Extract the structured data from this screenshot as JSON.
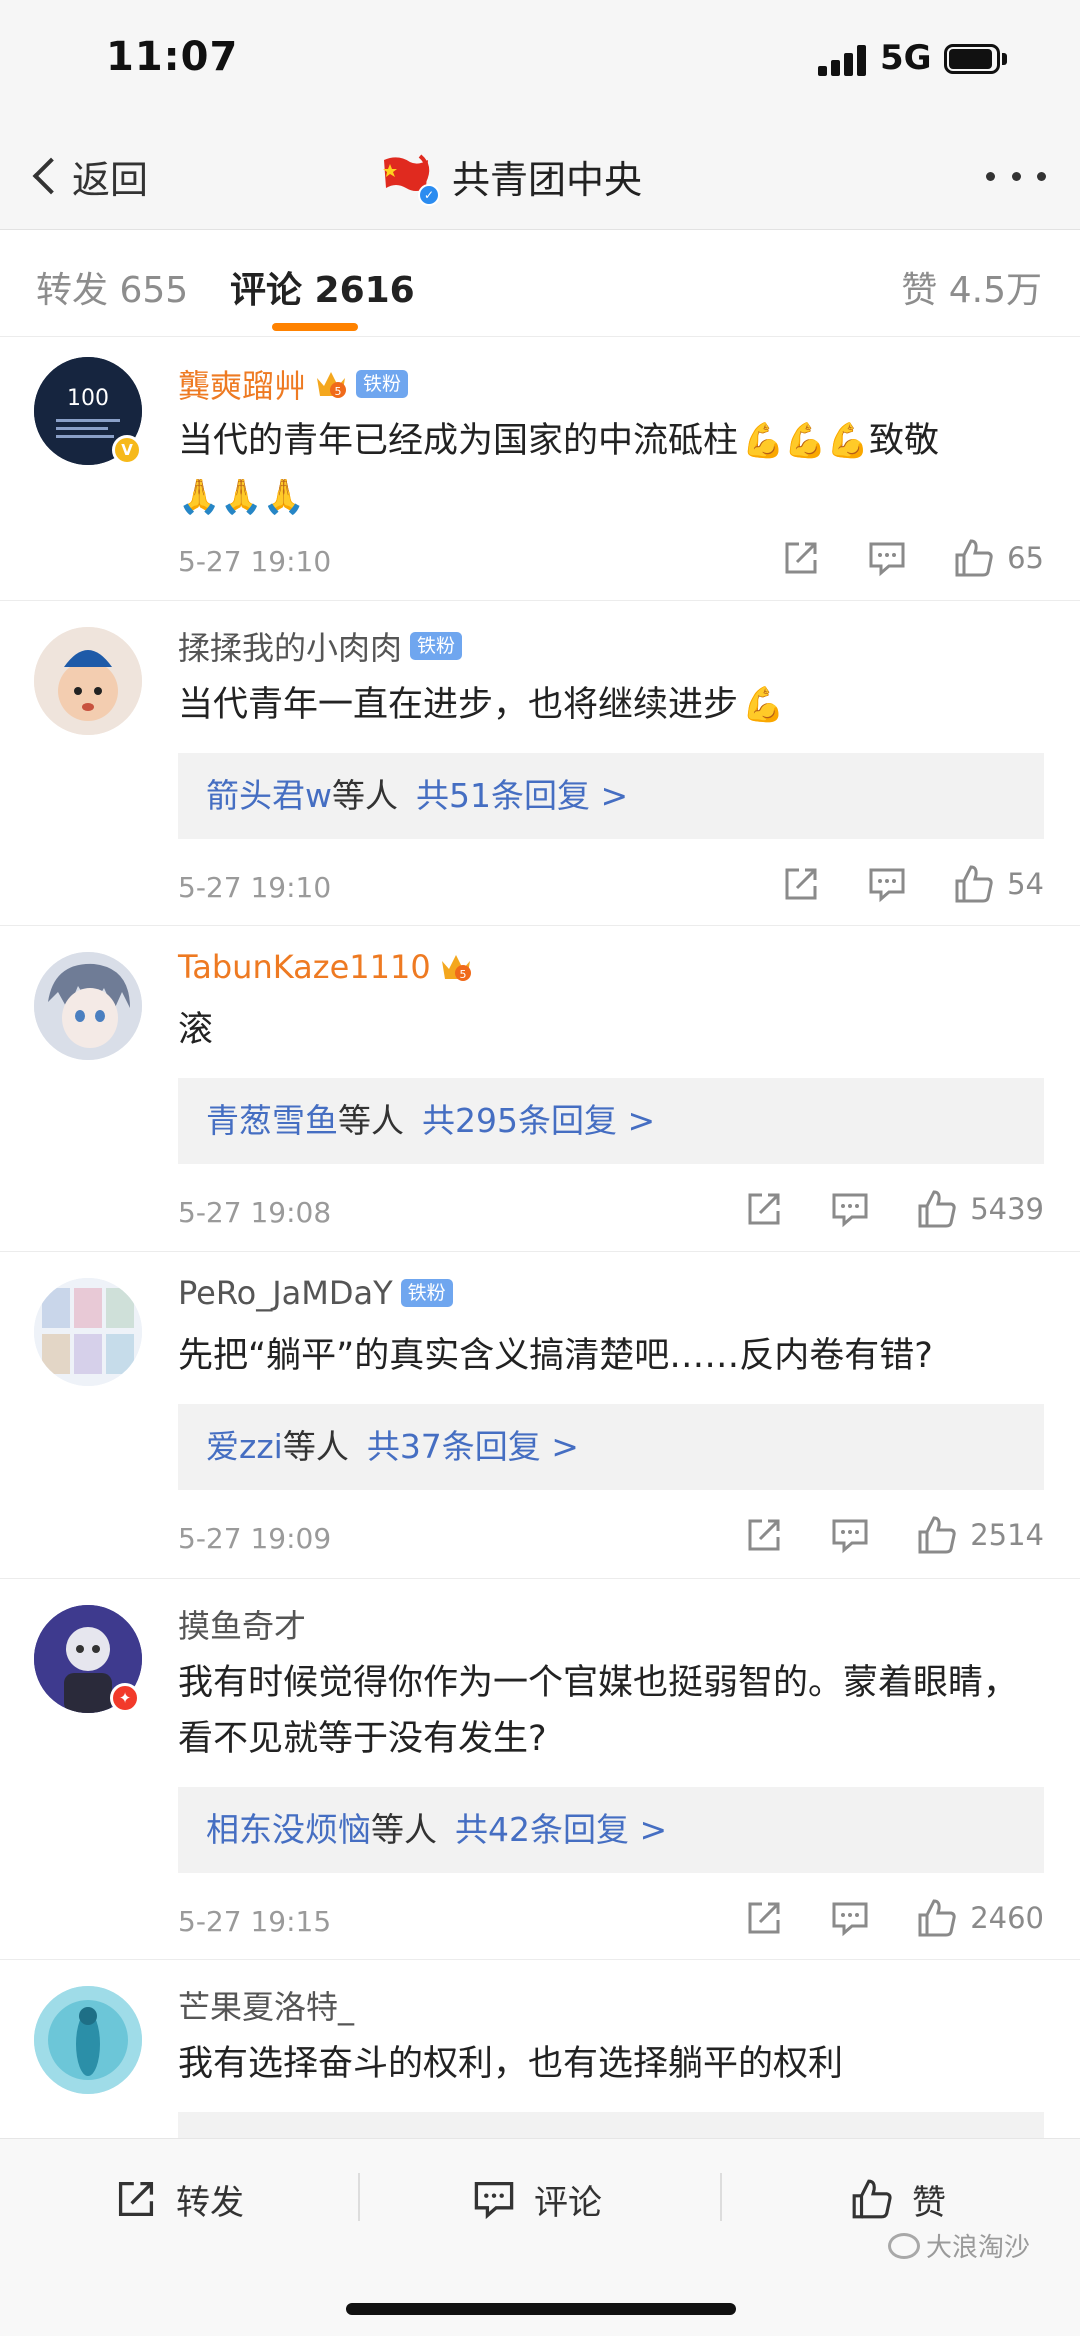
{
  "status_bar": {
    "time": "11:07",
    "network": "5G"
  },
  "nav": {
    "back_label": "返回",
    "title": "共青团中央"
  },
  "tabs": {
    "repost": "转发 655",
    "comment": "评论 2616",
    "like": "赞 4.5万"
  },
  "comments": [
    {
      "username": "龔奭蹓艸",
      "fan_badge": "铁粉",
      "text": "当代的青年已经成为国家的中流砥柱",
      "text_after_emoji": "致敬",
      "time": "5-27 19:10",
      "likes": "65"
    },
    {
      "username": "揉揉我的小肉肉",
      "fan_badge": "铁粉",
      "text": "当代青年一直在进步，也将继续进步",
      "reply_name": "箭头君w",
      "reply_etc": "等人",
      "reply_link": "共51条回复 >",
      "time": "5-27 19:10",
      "likes": "54"
    },
    {
      "username": "TabunKaze1110",
      "text": "滚",
      "reply_name": "青葱雪鱼",
      "reply_etc": "等人",
      "reply_link": "共295条回复 >",
      "time": "5-27 19:08",
      "likes": "5439"
    },
    {
      "username": "PeRo_JaMDaY",
      "fan_badge": "铁粉",
      "text": "先把“躺平”的真实含义搞清楚吧……反内卷有错?",
      "reply_name": "爱zzi",
      "reply_etc": "等人",
      "reply_link": "共37条回复 >",
      "time": "5-27 19:09",
      "likes": "2514"
    },
    {
      "username": "摸鱼奇才",
      "text": "我有时候觉得你作为一个官媒也挺弱智的。蒙着眼睛，看不见就等于没有发生?",
      "reply_name": "相东没烦恼",
      "reply_etc": "等人",
      "reply_link": "共42条回复 >",
      "time": "5-27 19:15",
      "likes": "2460"
    },
    {
      "username": "芒果夏洛特_",
      "text": "我有选择奋斗的权利，也有选择躺平的权利"
    }
  ],
  "bottom_bar": {
    "repost": "转发",
    "comment": "评论",
    "like": "赞"
  },
  "watermark": "大浪淘沙",
  "colors": {
    "accent": "#ff8200",
    "link": "#456ec2",
    "vip_name": "#ee7a22",
    "fan_badge": "#6fa6ef"
  },
  "icons": [
    "back-chevron-icon",
    "flag-logo-icon",
    "verified-icon",
    "more-icon",
    "share-icon",
    "comment-icon",
    "thumbs-up-icon",
    "crown-icon",
    "muscle-emoji-icon",
    "clap-emoji-icon"
  ]
}
